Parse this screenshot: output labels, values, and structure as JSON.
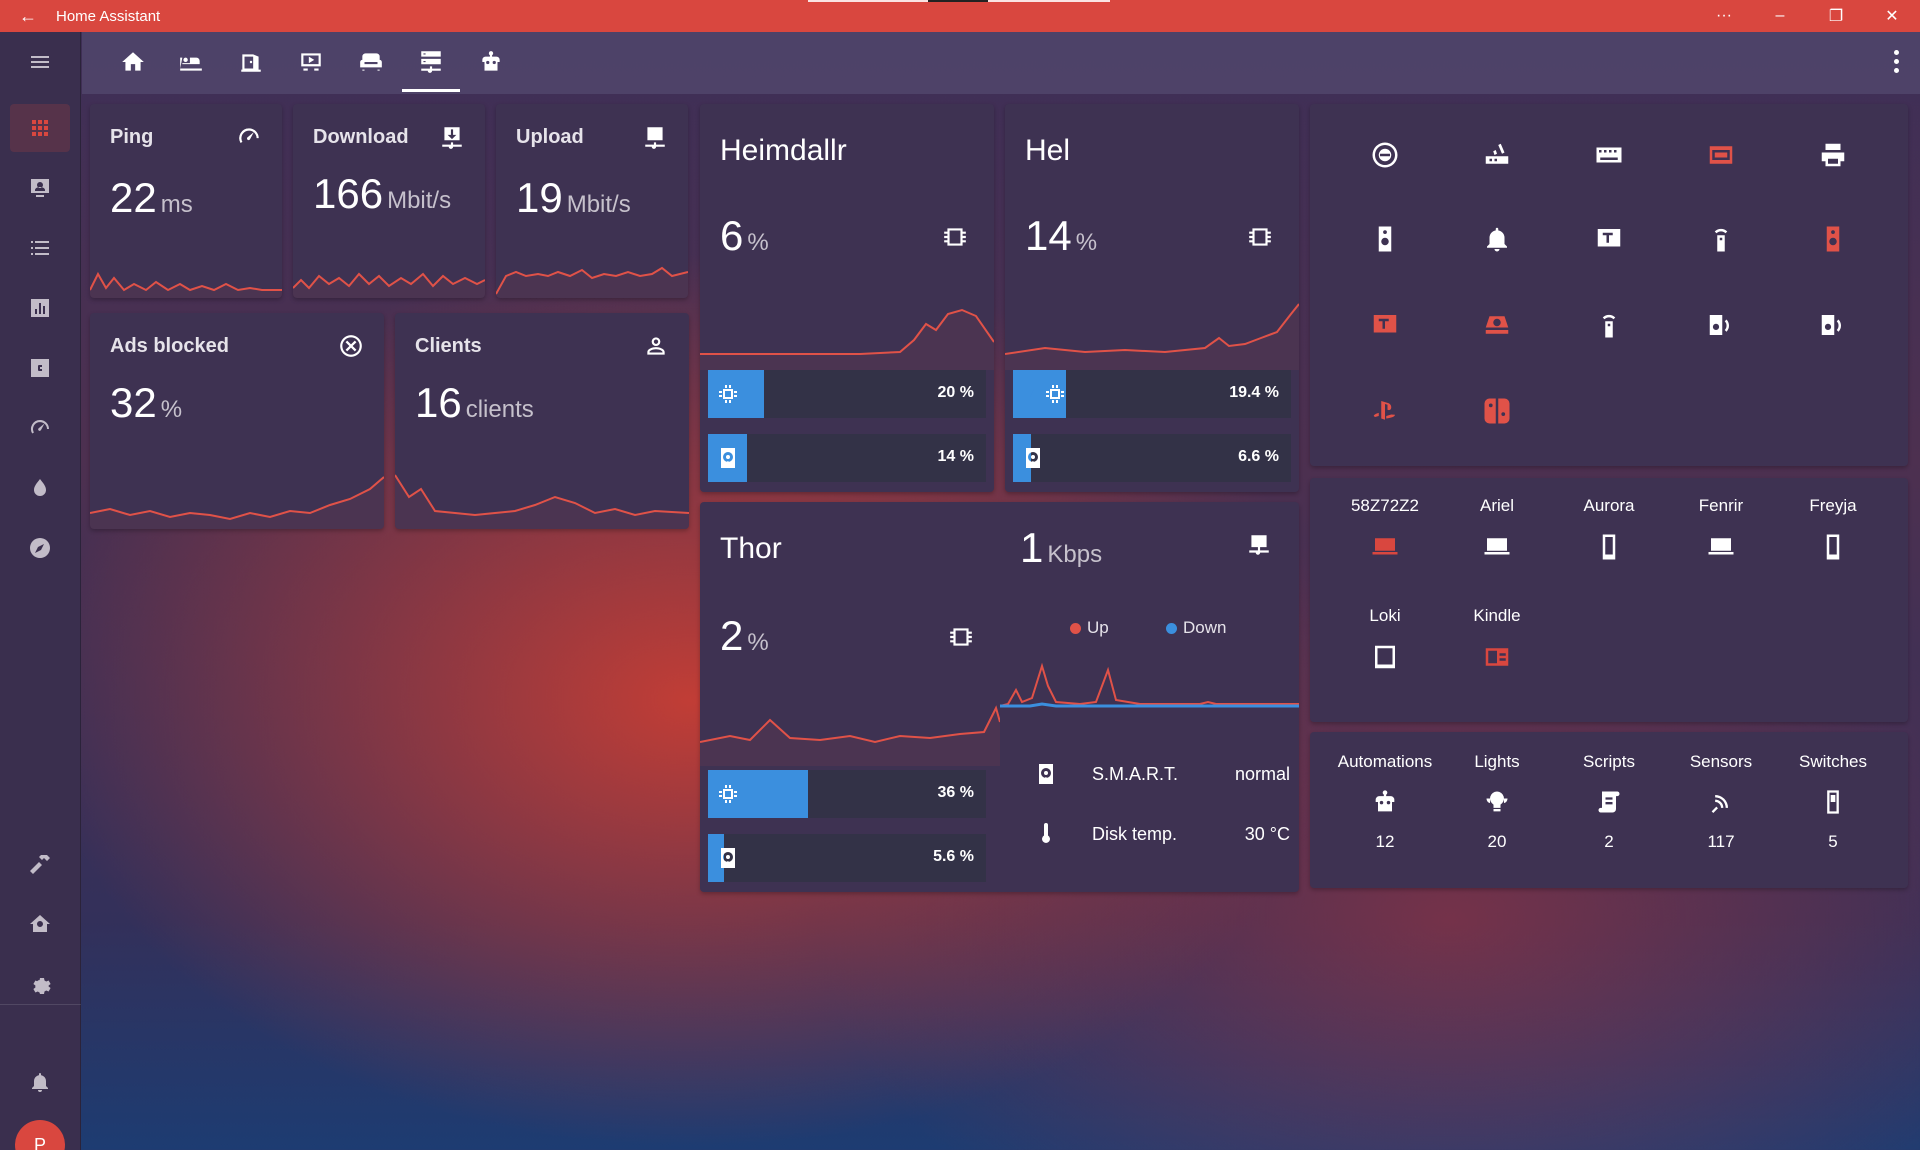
{
  "window": {
    "title": "Home Assistant"
  },
  "sidebar": {
    "items": [
      {
        "icon": "menu-icon"
      },
      {
        "icon": "dashboard-grid-icon"
      },
      {
        "icon": "account-card-icon"
      },
      {
        "icon": "list-icon"
      },
      {
        "icon": "chart-box-icon"
      },
      {
        "icon": "c-box-icon"
      },
      {
        "icon": "speedometer-icon"
      },
      {
        "icon": "drop-icon"
      },
      {
        "icon": "compass-icon"
      },
      {
        "icon": "hammer-icon"
      },
      {
        "icon": "home-gear-icon"
      },
      {
        "icon": "settings-icon"
      },
      {
        "icon": "bell-icon"
      }
    ],
    "user_initial": "P"
  },
  "toolbar": {
    "tabs": [
      "home-icon",
      "bed-icon",
      "door-open-icon",
      "projector-screen-icon",
      "sofa-icon",
      "server-network-icon",
      "robot-icon"
    ],
    "active_tab": 5
  },
  "network": {
    "ping": {
      "label": "Ping",
      "value": "22",
      "unit": "ms"
    },
    "download": {
      "label": "Download",
      "value": "166",
      "unit": "Mbit/s"
    },
    "upload": {
      "label": "Upload",
      "value": "19",
      "unit": "Mbit/s"
    },
    "ads": {
      "label": "Ads blocked",
      "value": "32",
      "unit": "%"
    },
    "clients": {
      "label": "Clients",
      "value": "16",
      "unit": "clients"
    }
  },
  "servers": {
    "heimdallr": {
      "name": "Heimdallr",
      "cpu": "6",
      "unit": "%",
      "bar1": "20 %",
      "bar1_fill": 0.2,
      "bar2": "14 %",
      "bar2_fill": 0.14
    },
    "hel": {
      "name": "Hel",
      "cpu": "14",
      "unit": "%",
      "bar1": "19.4 %",
      "bar1_fill": 0.19,
      "bar2": "6.6 %",
      "bar2_fill": 0.066
    },
    "thor": {
      "name": "Thor",
      "cpu": "2",
      "unit": "%",
      "bar1": "36 %",
      "bar1_fill": 0.36,
      "bar2": "5.6 %",
      "bar2_fill": 0.056,
      "net_value": "1",
      "net_unit": "Kbps",
      "legend_up": "Up",
      "legend_down": "Down",
      "smart_label": "S.M.A.R.T.",
      "smart_value": "normal",
      "temp_label": "Disk temp.",
      "temp_value": "30 °C"
    }
  },
  "devices": [
    {
      "name": "58Z72Z2",
      "type": "laptop",
      "on": true
    },
    {
      "name": "Ariel",
      "type": "laptop",
      "on": false
    },
    {
      "name": "Aurora",
      "type": "phone",
      "on": false
    },
    {
      "name": "Fenrir",
      "type": "laptop",
      "on": false
    },
    {
      "name": "Freyja",
      "type": "phone",
      "on": false
    },
    {
      "name": "Loki",
      "type": "tablet",
      "on": false
    },
    {
      "name": "Kindle",
      "type": "ebook",
      "on": true
    }
  ],
  "summary": [
    {
      "name": "Automations",
      "icon": "robot-icon",
      "count": "12"
    },
    {
      "name": "Lights",
      "icon": "lightbulb-group-icon",
      "count": "20"
    },
    {
      "name": "Scripts",
      "icon": "script-icon",
      "count": "2"
    },
    {
      "name": "Sensors",
      "icon": "sensor-icon",
      "count": "117"
    },
    {
      "name": "Switches",
      "icon": "switch-icon",
      "count": "5"
    }
  ],
  "colors": {
    "accent": "#d9473f",
    "blue": "#3b8fde",
    "card": "#3e3252"
  }
}
